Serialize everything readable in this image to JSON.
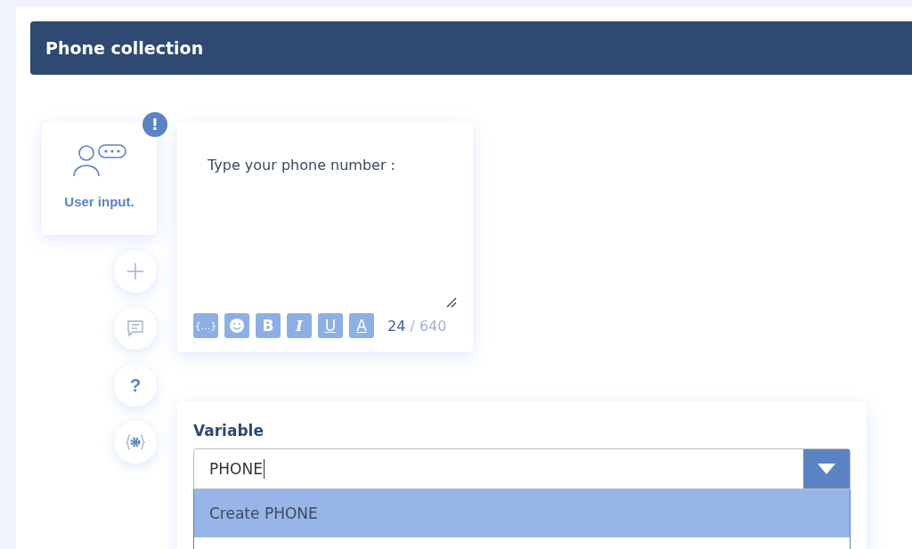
{
  "header": {
    "title": "Phone collection"
  },
  "block": {
    "label": "User input.",
    "alert_badge": "!"
  },
  "side_actions": [
    {
      "kind": "add"
    },
    {
      "kind": "message"
    },
    {
      "kind": "help",
      "text": "?"
    },
    {
      "kind": "settings"
    }
  ],
  "editor": {
    "text": "Type your phone number :",
    "tools": [
      {
        "kind": "variable",
        "text": "{...}"
      },
      {
        "kind": "emoji"
      },
      {
        "kind": "bold",
        "text": "B"
      },
      {
        "kind": "italic",
        "text": "I"
      },
      {
        "kind": "underline",
        "text": "U"
      },
      {
        "kind": "color",
        "text": "A"
      }
    ],
    "count": "24",
    "limit": "/ 640"
  },
  "variable": {
    "label": "Variable",
    "value": "PHONE",
    "options": [
      {
        "label": "Create PHONE",
        "selected": true
      }
    ]
  }
}
